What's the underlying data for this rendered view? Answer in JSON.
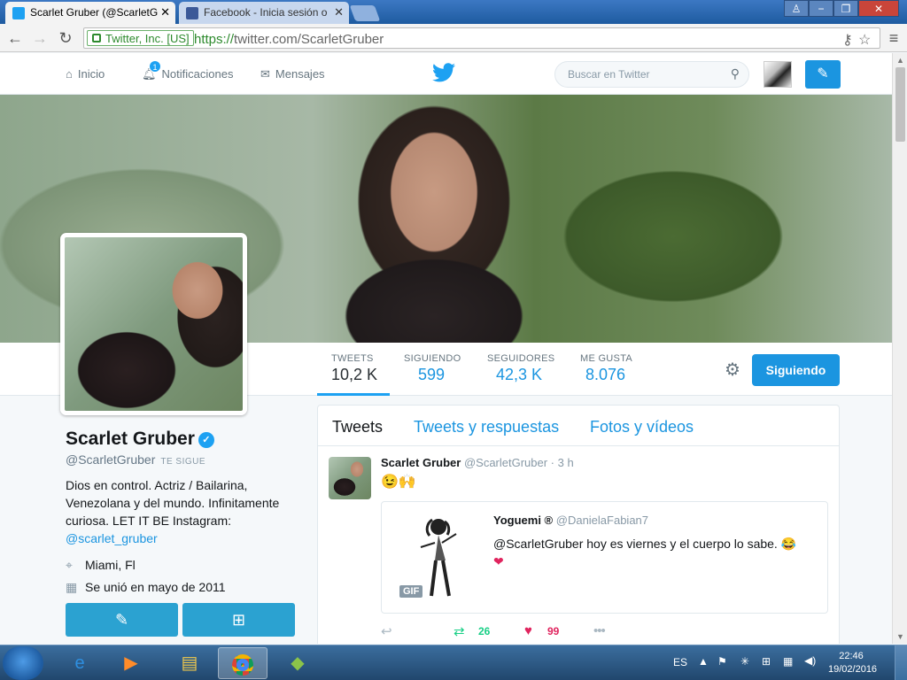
{
  "browser": {
    "tabs": [
      {
        "title": "Scarlet Gruber (@ScarletG",
        "close": "✕",
        "favicon_color": "#1da1f2"
      },
      {
        "title": "Facebook - Inicia sesión o",
        "close": "✕",
        "favicon_color": "#3b5998"
      }
    ],
    "address": {
      "secure_label": "Twitter, Inc. [US]",
      "scheme": "https://",
      "rest": "twitter.com/ScarletGruber"
    },
    "window_buttons": [
      "−",
      "❐",
      "✕"
    ]
  },
  "twitter": {
    "nav": {
      "home": "Inicio",
      "notifications": "Notificaciones",
      "notifications_count": "1",
      "messages": "Mensajes",
      "search_placeholder": "Buscar en Twitter"
    },
    "stats": [
      {
        "label": "TWEETS",
        "value": "10,2 K"
      },
      {
        "label": "SIGUIENDO",
        "value": "599"
      },
      {
        "label": "SEGUIDORES",
        "value": "42,3 K"
      },
      {
        "label": "ME GUSTA",
        "value": "8.076"
      }
    ],
    "follow_button": "Siguiendo",
    "profile": {
      "name": "Scarlet Gruber",
      "handle": "@ScarletGruber",
      "follows_you": "TE SIGUE",
      "bio": "Dios en control. Actriz / Bailarina, Venezolana y del mundo. Infinitamente curiosa. LET IT BE Instagram:",
      "bio_link": "@scarlet_gruber",
      "location": "Miami, Fl",
      "joined": "Se unió en mayo de 2011"
    },
    "timeline_tabs": [
      "Tweets",
      "Tweets y respuestas",
      "Fotos y vídeos"
    ],
    "tweet": {
      "name": "Scarlet Gruber",
      "handle": "@ScarletGruber · 3 h",
      "emoji": "😉🙌",
      "quote": {
        "name": "Yoguemi ®",
        "handle": "@DanielaFabian7",
        "text": "@ScarletGruber hoy es viernes y el cuerpo lo sabe. 😂",
        "heart": "❤",
        "gif_label": "GIF"
      },
      "retweets": "26",
      "likes": "99"
    }
  },
  "taskbar": {
    "lang": "ES",
    "time": "22:46",
    "date": "19/02/2016"
  },
  "colors": {
    "accent": "#1da1f2",
    "link": "#1b95e0"
  }
}
